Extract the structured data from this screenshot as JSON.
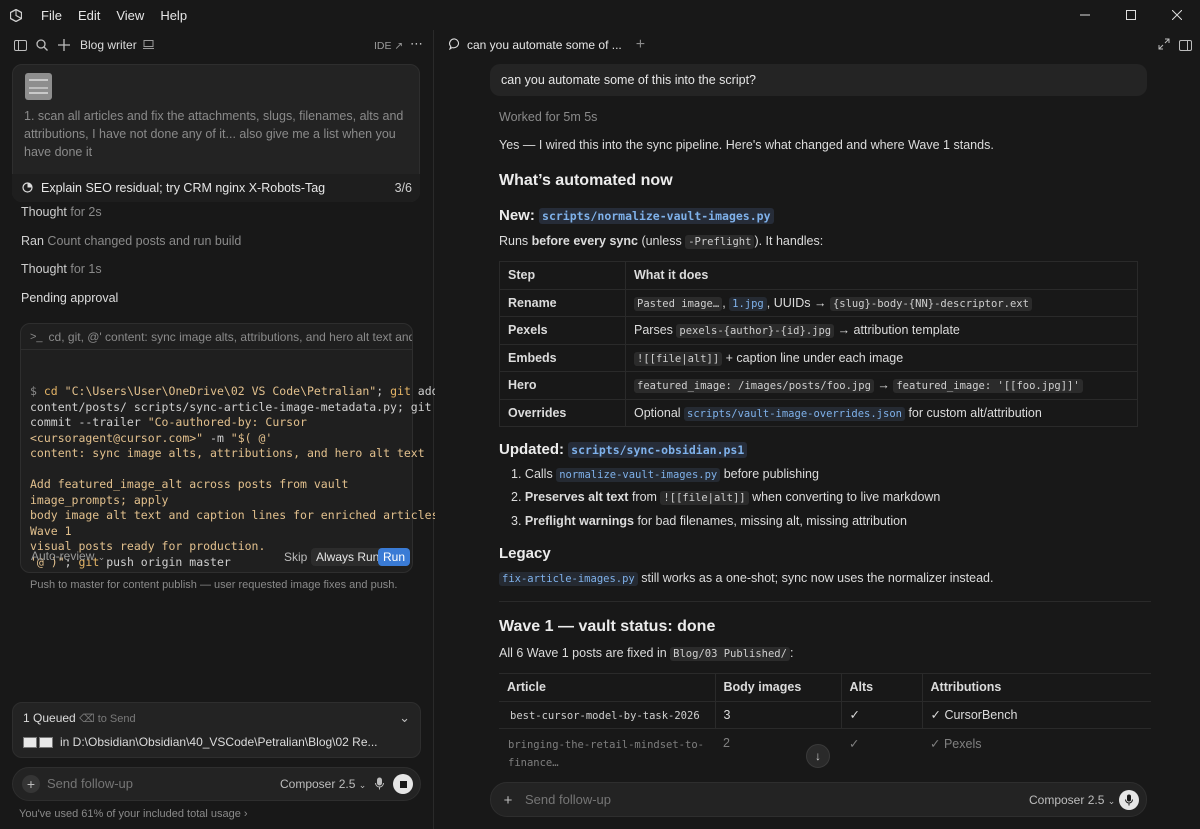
{
  "menu": {
    "file": "File",
    "edit": "Edit",
    "view": "View",
    "help": "Help"
  },
  "left": {
    "title": "Blog writer",
    "ide_label": "IDE ↗",
    "message": "1. scan all articles and fix the attachments, slugs, filenames, alts and attributions, I have not done any of it... also give me a list when you have done it",
    "task_label": "Explain SEO residual; try CRM nginx X-Robots-Tag",
    "task_count": "3/6",
    "steps": [
      {
        "verb": "Thought",
        "detail": "for 2s"
      },
      {
        "verb": "Ran",
        "detail": "Count changed posts and run build"
      },
      {
        "verb": "Thought",
        "detail": "for 1s"
      }
    ],
    "pending": "Pending approval",
    "cmd_input": "cd, git, @' content: sync image alts, attributions, and hero alt text and fil",
    "auto_review": "Auto-review",
    "skip": "Skip",
    "always_run": "Always Run",
    "run": "Run",
    "push_note": "Push to master for content publish — user requested image fixes and push.",
    "queued": "1 Queued",
    "to_send": "to Send",
    "queued_path": "in D:\\Obsidian\\Obsidian\\40_VSCode\\Petralian\\Blog\\02 Re...",
    "followup_placeholder": "Send follow-up",
    "model": "Composer 2.5",
    "usage": "You've used 61% of your included total usage"
  },
  "right": {
    "tab_title": "can you automate some of ...",
    "user_message": "can you automate some of this into the script?",
    "worked": "Worked for 5m 5s",
    "intro": "Yes — I wired this into the sync pipeline. Here's what changed and where Wave 1 stands.",
    "h_auto": "What’s automated now",
    "h_new": "New:",
    "new_file": "scripts/normalize-vault-images.py",
    "runs_a": "Runs ",
    "runs_b": "before every sync",
    "runs_c": " (unless ",
    "runs_code": "-Preflight",
    "runs_d": "). It handles:",
    "table1": {
      "headers": [
        "Step",
        "What it does"
      ],
      "rows": [
        [
          "Rename",
          "Pasted image…, 1.jpg, UUIDs → {slug}-body-{NN}-descriptor.ext"
        ],
        [
          "Pexels",
          "Parses pexels-{author}-{id}.jpg → attribution template"
        ],
        [
          "Embeds",
          "![[file|alt]] + caption line under each image"
        ],
        [
          "Hero",
          "featured_image: /images/posts/foo.jpg → featured_image: '[[foo.jpg]]'"
        ],
        [
          "Overrides",
          "Optional scripts/vault-image-overrides.json for custom alt/attribution"
        ]
      ]
    },
    "h_updated": "Updated:",
    "updated_file": "scripts/sync-obsidian.ps1",
    "list": [
      {
        "n": "1.",
        "a": "Calls ",
        "code": "normalize-vault-images.py",
        "b": " before publishing"
      },
      {
        "n": "2.",
        "bold": "Preserves alt text",
        "a": " from ",
        "code": "![[file|alt]]",
        "b": " when converting to live markdown"
      },
      {
        "n": "3.",
        "bold": "Preflight warnings",
        "b": " for bad filenames, missing alt, missing attribution"
      }
    ],
    "h_legacy": "Legacy",
    "legacy_code": "fix-article-images.py",
    "legacy_text": " still works as a one-shot; sync now uses the normalizer instead.",
    "h_wave": "Wave 1 — vault status: done",
    "wave_a": "All 6 Wave 1 posts are fixed in ",
    "wave_code": "Blog/03 Published/",
    "wave_b": ":",
    "table2": {
      "headers": [
        "Article",
        "Body images",
        "Alts",
        "Attributions"
      ],
      "rows": [
        [
          "best-cursor-model-by-task-2026",
          "3",
          "✓",
          "✓ CursorBench"
        ],
        [
          "bringing-the-retail-mindset-to-finance…",
          "2",
          "✓",
          "✓ Pexels"
        ]
      ]
    },
    "followup_placeholder": "Send follow-up",
    "model": "Composer 2.5"
  }
}
